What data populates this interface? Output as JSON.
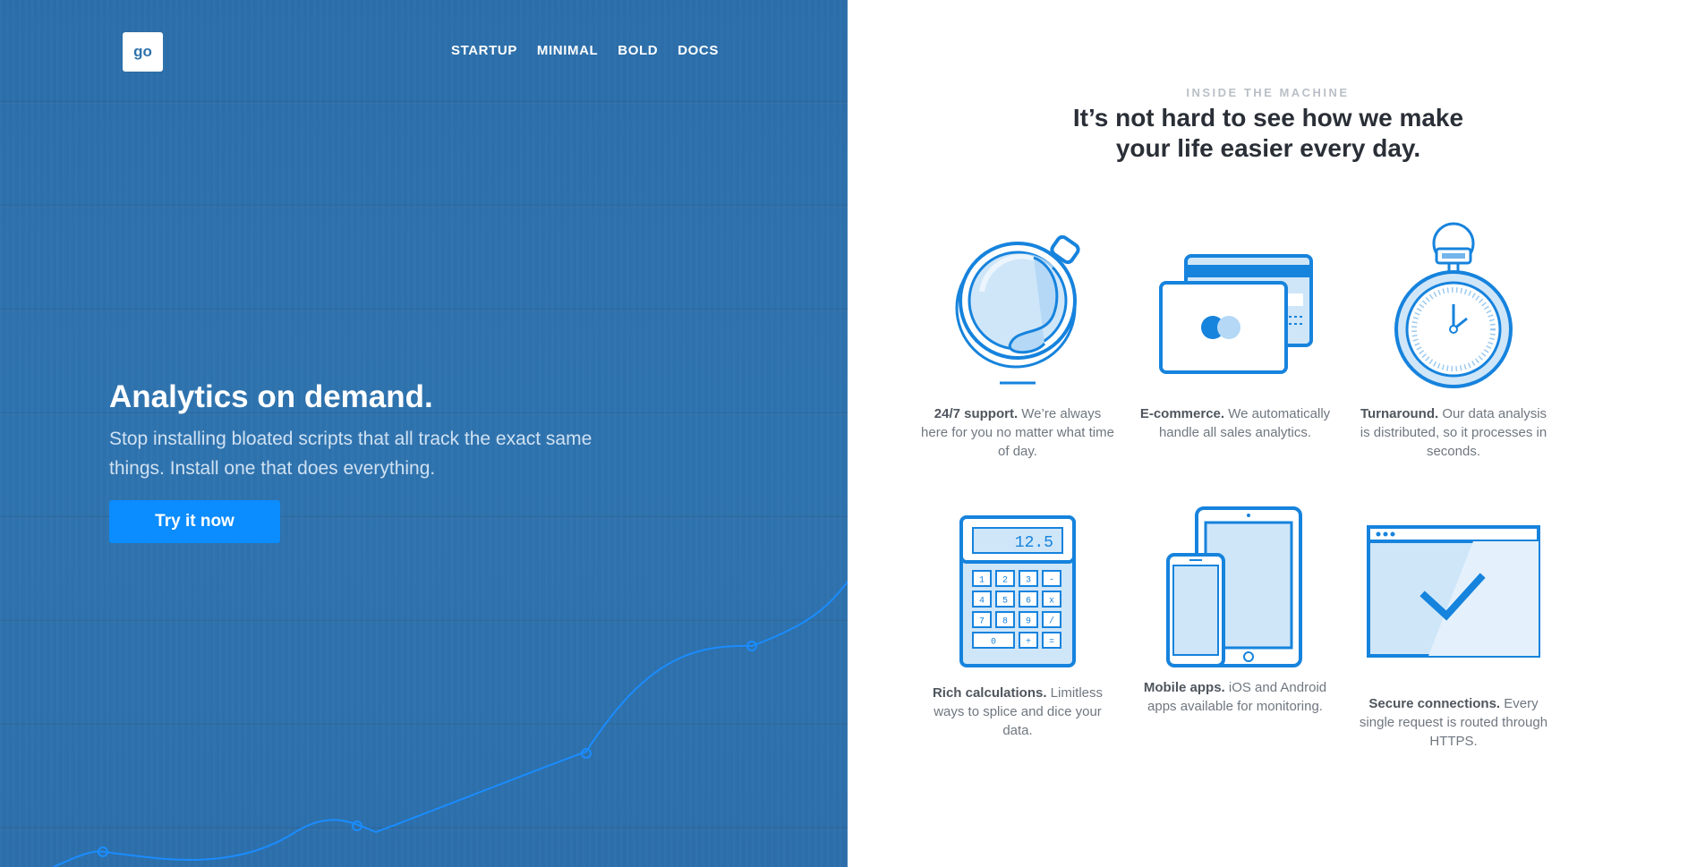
{
  "brand": {
    "logo_text": "go"
  },
  "nav": {
    "items": [
      "STARTUP",
      "MINIMAL",
      "BOLD",
      "DOCS"
    ]
  },
  "hero": {
    "title": "Analytics on demand.",
    "subtitle": "Stop installing bloated scripts that all track the exact same things. Install one that does everything.",
    "cta_label": "Try it now"
  },
  "features_section": {
    "eyebrow": "INSIDE THE MACHINE",
    "title": "It’s not hard to see how we make your life easier every day.",
    "items": [
      {
        "name": "24/7 support.",
        "text": "We’re always here for you no matter what time of day.",
        "icon": "coffee-cup-icon"
      },
      {
        "name": "E-commerce.",
        "text": "We automatically handle all sales analytics.",
        "icon": "credit-card-icon"
      },
      {
        "name": "Turnaround.",
        "text": "Our data analysis is distributed, so it processes in seconds.",
        "icon": "stopwatch-icon"
      },
      {
        "name": "Rich calculations.",
        "text": "Limitless ways to splice and dice your data.",
        "icon": "calculator-icon"
      },
      {
        "name": "Mobile apps.",
        "text": "iOS and Android apps available for monitoring.",
        "icon": "mobile-devices-icon"
      },
      {
        "name": "Secure connections.",
        "text": "Every single request is routed through HTTPS.",
        "icon": "secure-browser-icon"
      }
    ],
    "calculator_display": "12.5",
    "calculator_keys": [
      "1",
      "2",
      "3",
      "-",
      "4",
      "5",
      "6",
      "x",
      "7",
      "8",
      "9",
      "/",
      "0",
      "+",
      "="
    ]
  },
  "colors": {
    "hero_bg": "#2e72ad",
    "accent": "#0b8cff",
    "icon_stroke": "#1683dd",
    "icon_fill": "#cfe6f9"
  }
}
